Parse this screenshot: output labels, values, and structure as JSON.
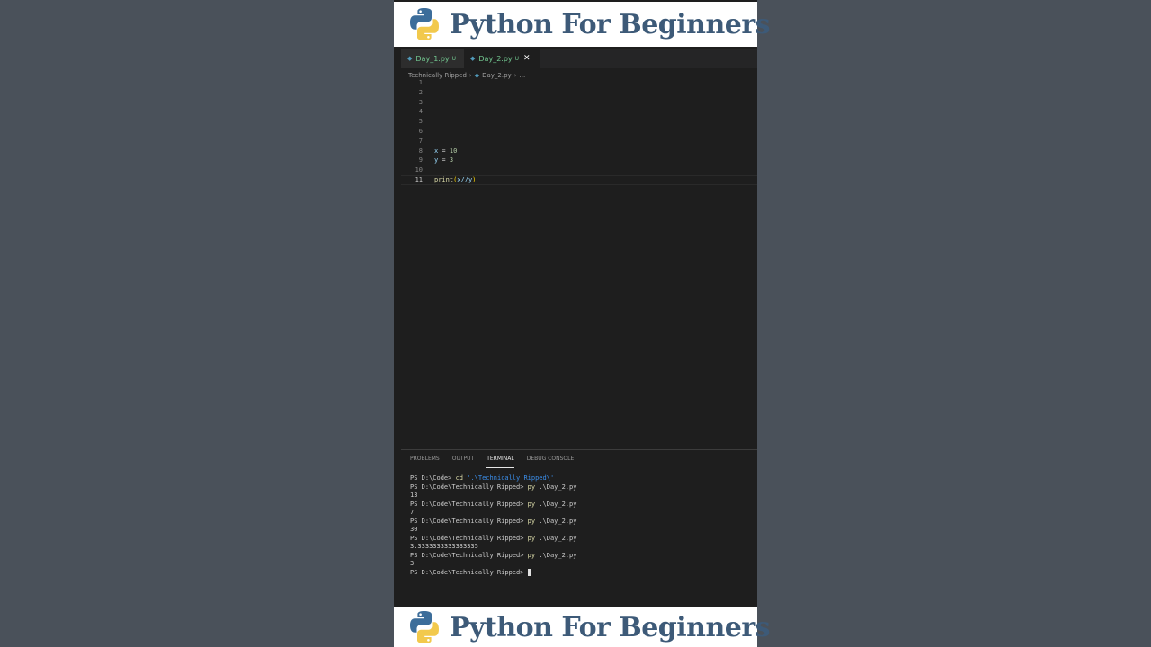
{
  "banner": {
    "title": "Python For Beginners"
  },
  "tabs": [
    {
      "label": "Day_1.py",
      "status": "U",
      "active": false
    },
    {
      "label": "Day_2.py",
      "status": "U",
      "active": true
    }
  ],
  "breadcrumb": {
    "folder": "Technically Ripped",
    "file": "Day_2.py",
    "more": "..."
  },
  "code": {
    "lines": [
      "1",
      "2",
      "3",
      "4",
      "5",
      "6",
      "7",
      "8",
      "9",
      "10",
      "11"
    ],
    "line8": {
      "var": "x",
      "op": " = ",
      "val": "10"
    },
    "line9": {
      "var": "y",
      "op": " = ",
      "val": "3"
    },
    "line11": {
      "fn": "print",
      "open": "(",
      "arg": "x//y",
      "close": ")"
    }
  },
  "panel": {
    "tabs": [
      "PROBLEMS",
      "OUTPUT",
      "TERMINAL",
      "DEBUG CONSOLE"
    ],
    "active_tab": "TERMINAL"
  },
  "terminal": {
    "prompt1": "PS D:\\Code> ",
    "cd_cmd": "cd",
    "cd_arg": " '.\\Technically Ripped\\'",
    "prompt": "PS D:\\Code\\Technically Ripped> ",
    "py_cmd": "py",
    "py_arg": " .\\Day_2.py",
    "outputs": [
      "13",
      "7",
      "30",
      "3.3333333333333335",
      "3"
    ]
  },
  "colors": {
    "accent_banner": "#3d5a78",
    "tab_modified": "#73c991",
    "python_icon": "#519aba"
  }
}
